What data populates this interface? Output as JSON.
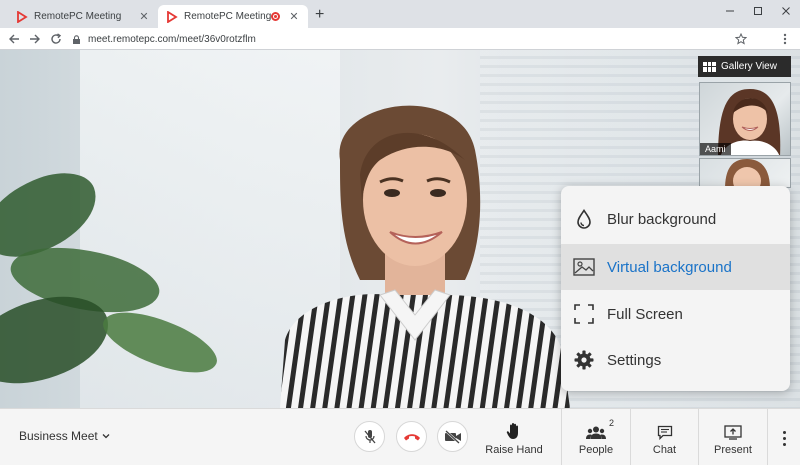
{
  "browser": {
    "tabs": [
      {
        "title": "RemotePC Meeting",
        "active": false
      },
      {
        "title": "RemotePC Meeting",
        "active": true,
        "recording": true
      }
    ],
    "new_tab": "+",
    "url": "meet.remotepc.com/meet/36v0rotzflm",
    "window_controls": [
      "minimize-icon",
      "maximize-icon",
      "close-icon"
    ]
  },
  "gallery": {
    "button_label": "Gallery View",
    "participants": [
      {
        "name": "Aami"
      }
    ]
  },
  "menu": {
    "items": [
      {
        "label": "Blur background",
        "icon": "droplet-icon",
        "selected": false
      },
      {
        "label": "Virtual background",
        "icon": "image-icon",
        "selected": true
      },
      {
        "label": "Full Screen",
        "icon": "fullscreen-icon",
        "selected": false
      },
      {
        "label": "Settings",
        "icon": "gear-icon",
        "selected": false
      }
    ]
  },
  "toolbar": {
    "meeting_name": "Business Meet",
    "raise_hand": "Raise Hand",
    "people": "People",
    "people_count": "2",
    "chat": "Chat",
    "present": "Present"
  },
  "colors": {
    "accent": "#1a73c8",
    "end_call": "#e53935",
    "menu_bg": "#f4f4f4",
    "toolbar_bg": "#f5f5f5"
  }
}
